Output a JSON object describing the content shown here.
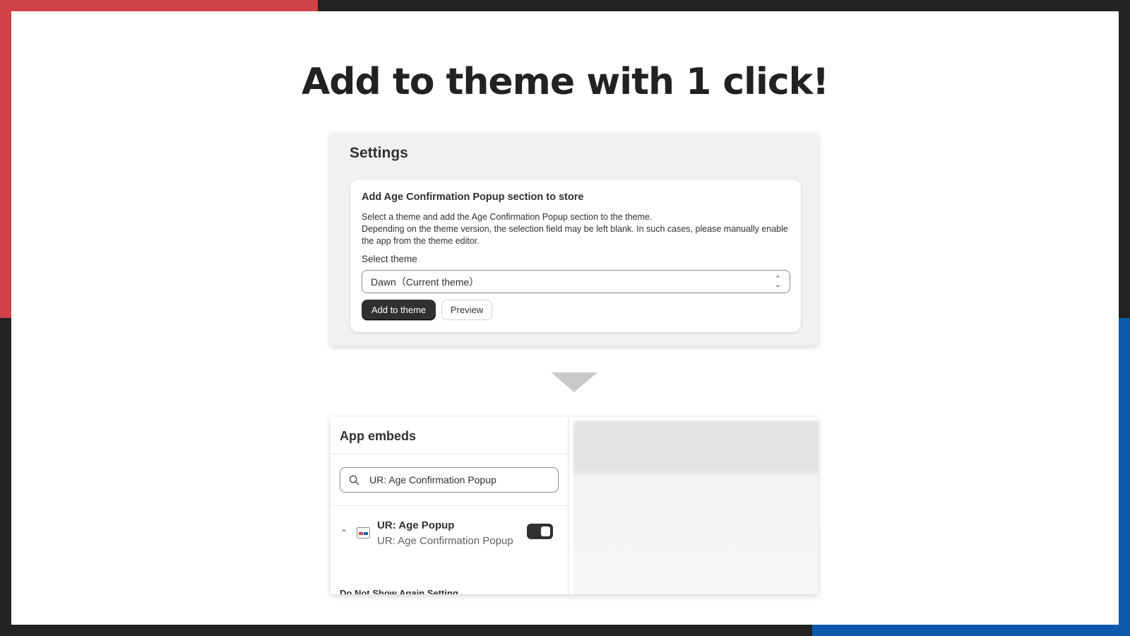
{
  "headline": "Add to theme with 1 click!",
  "colors": {
    "red_accent": "#d04148",
    "blue_accent": "#0d5bab",
    "dark": "#232323"
  },
  "settings": {
    "title": "Settings",
    "card": {
      "heading": "Add Age Confirmation Popup section to store",
      "desc_line1": "Select a theme and add the Age Confirmation Popup section to the theme.",
      "desc_line2": "Depending on the theme version, the selection field may be left blank. In such cases, please manually enable the app from the theme editor.",
      "select_label": "Select theme",
      "select_value": "Dawn（Current theme）",
      "primary_button": "Add to theme",
      "secondary_button": "Preview"
    }
  },
  "arrow_icon": "down-triangle-icon",
  "app_embeds": {
    "title": "App embeds",
    "search_value": "UR: Age Confirmation Popup",
    "item": {
      "name": "UR: Age Popup",
      "subtitle": "UR: Age Confirmation Popup",
      "enabled": true
    },
    "truncated_label": "Do Not Show Again Setting"
  }
}
